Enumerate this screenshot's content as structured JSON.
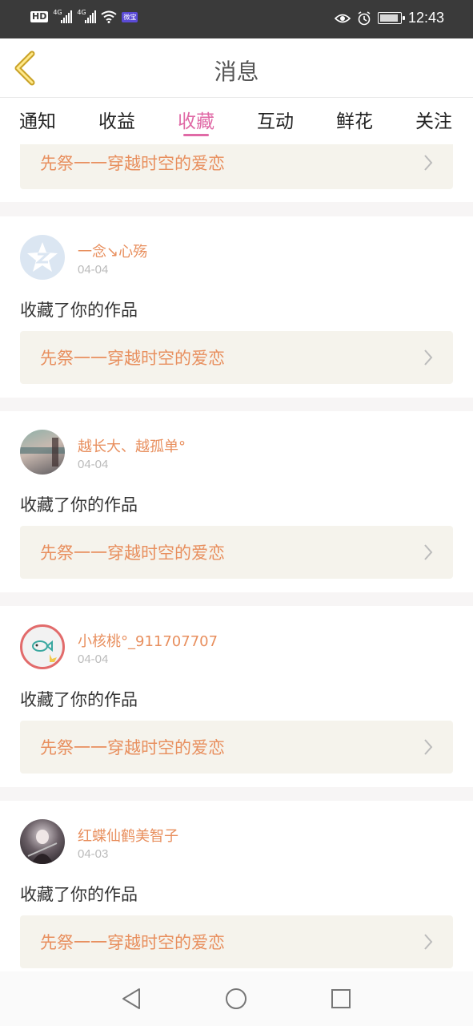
{
  "status_bar": {
    "hd": "HD",
    "sig1": "4G",
    "sig2": "4G",
    "badge": "微宝",
    "time": "12:43"
  },
  "header": {
    "title": "消息"
  },
  "tabs": [
    {
      "label": "通知",
      "active": false
    },
    {
      "label": "收益",
      "active": false
    },
    {
      "label": "收藏",
      "active": true
    },
    {
      "label": "互动",
      "active": false
    },
    {
      "label": "鲜花",
      "active": false
    },
    {
      "label": "关注",
      "active": false
    }
  ],
  "partial_item": {
    "work_title": "先祭一一穿越时空的爱恋"
  },
  "items": [
    {
      "username": "一念↘心殇",
      "date": "04-04",
      "action": "收藏了你的作品",
      "work_title": "先祭一一穿越时空的爱恋",
      "avatar": "qzone-avatar"
    },
    {
      "username": "越长大、越孤单°",
      "date": "04-04",
      "action": "收藏了你的作品",
      "work_title": "先祭一一穿越时空的爱恋",
      "avatar": "photo-avatar"
    },
    {
      "username": "小核桃°_911707707",
      "date": "04-04",
      "action": "收藏了你的作品",
      "work_title": "先祭一一穿越时空的爱恋",
      "avatar": "fish-avatar"
    },
    {
      "username": "红蝶仙鹤美智子",
      "date": "04-03",
      "action": "收藏了你的作品",
      "work_title": "先祭一一穿越时空的爱恋",
      "avatar": "anime-avatar"
    }
  ],
  "colors": {
    "accent": "#e06aa6",
    "name": "#e88f5e",
    "card_bg": "#f5f3ec"
  }
}
